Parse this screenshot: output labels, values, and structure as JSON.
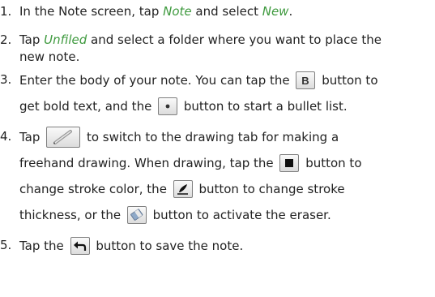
{
  "steps": [
    {
      "number": "1.",
      "parts": [
        "In the Note screen, tap ",
        "Note",
        " and select ",
        "New",
        "."
      ]
    },
    {
      "number": "2.",
      "parts": [
        "Tap ",
        "Unfiled",
        " and select a folder where you want to place the",
        "new note."
      ]
    },
    {
      "number": "3.",
      "parts": [
        "Enter the body of your note. You can tap the ",
        " button to",
        "get bold text, and the ",
        " button to start a bullet list."
      ]
    },
    {
      "number": "4.",
      "parts": [
        "Tap ",
        " to switch to the drawing tab for making a",
        "freehand drawing. When drawing, tap the ",
        " button to",
        "change stroke color, the ",
        " button to change stroke",
        "thickness, or the ",
        " button to activate the eraser."
      ]
    },
    {
      "number": "5.",
      "parts": [
        "Tap the ",
        " button to save the note."
      ]
    }
  ],
  "icons": {
    "bold": {
      "name": "bold-button-icon",
      "letter": "B"
    },
    "bullet": {
      "name": "bullet-list-button-icon"
    },
    "drawing": {
      "name": "drawing-tab-pencil-icon"
    },
    "color": {
      "name": "stroke-color-button-icon"
    },
    "thickness": {
      "name": "stroke-thickness-button-icon"
    },
    "eraser": {
      "name": "eraser-button-icon"
    },
    "save": {
      "name": "save-back-arrow-icon"
    }
  },
  "colors": {
    "text": "#222222",
    "ui_term": "#3f9a3f",
    "button_border": "#7f7f7f"
  }
}
